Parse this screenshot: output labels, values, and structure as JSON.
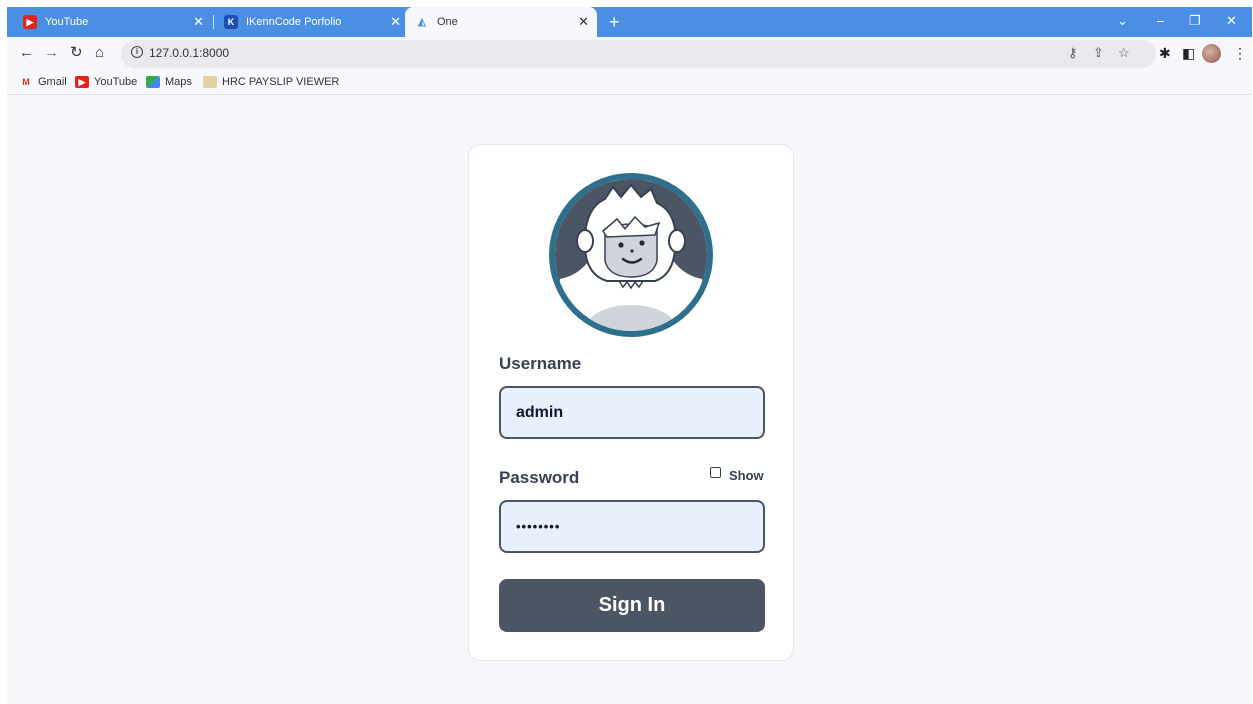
{
  "browser": {
    "tabs": [
      {
        "label": "YouTube",
        "icon": "youtube-icon",
        "active": false
      },
      {
        "label": "IKennCode Porfolio",
        "icon": "k-logo-icon",
        "active": false
      },
      {
        "label": "One",
        "icon": "page-icon",
        "active": true
      }
    ],
    "url": "127.0.0.1:8000",
    "bookmarks": [
      {
        "label": "Gmail",
        "icon": "gmail-icon"
      },
      {
        "label": "YouTube",
        "icon": "youtube-icon"
      },
      {
        "label": "Maps",
        "icon": "maps-icon"
      },
      {
        "label": "HRC PAYSLIP VIEWER",
        "icon": "folder-icon"
      }
    ],
    "accent": "#4a8fe3"
  },
  "login": {
    "avatar": "yeti-avatar",
    "username_label": "Username",
    "username_value": "admin",
    "password_label": "Password",
    "password_value": "••••••••",
    "show_label": "Show",
    "show_checked": false,
    "signin_label": "Sign In",
    "button_color": "#4b5563",
    "avatar_ring_color": "#2e6f8d"
  }
}
